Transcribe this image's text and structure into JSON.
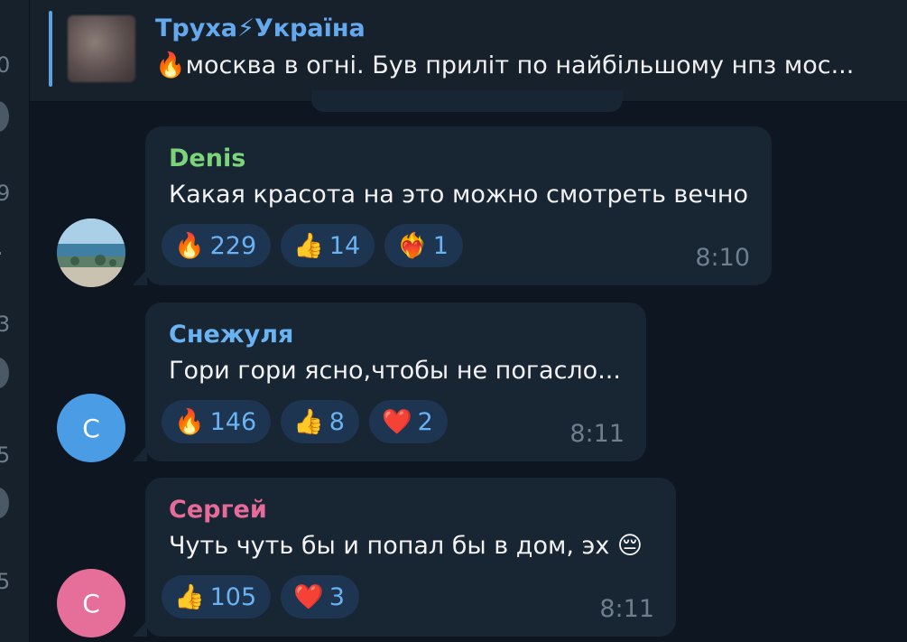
{
  "left_strip": {
    "digits": [
      "0",
      "9",
      ".",
      "3",
      "5",
      "5"
    ]
  },
  "pinned": {
    "title": "Труха⚡Україна",
    "text": "🔥москва в огні.  Був приліт по найбільшому нпз мос..."
  },
  "messages": [
    {
      "author": "Denis",
      "author_color": "#7cd47a",
      "text": "Какая красота на это можно смотреть вечно",
      "reactions": [
        {
          "emoji": "🔥",
          "count": "229"
        },
        {
          "emoji": "👍",
          "count": "14"
        },
        {
          "emoji": "❤️‍🔥",
          "count": "1"
        }
      ],
      "time": "8:10",
      "avatar": {
        "type": "photo",
        "letter": ""
      }
    },
    {
      "author": "Снежуля",
      "author_color": "#6ab3f3",
      "text": "Гори гори ясно,чтобы не погасло...",
      "reactions": [
        {
          "emoji": "🔥",
          "count": "146"
        },
        {
          "emoji": "👍",
          "count": "8"
        },
        {
          "emoji": "❤️",
          "count": "2"
        }
      ],
      "time": "8:11",
      "avatar": {
        "type": "letter",
        "letter": "С",
        "color": "#4a9ce4"
      }
    },
    {
      "author": "Сергей",
      "author_color": "#e66b9a",
      "text": "Чуть чуть бы и попал бы в дом, эх 😔",
      "reactions": [
        {
          "emoji": "👍",
          "count": "105"
        },
        {
          "emoji": "❤️",
          "count": "3"
        }
      ],
      "time": "8:11",
      "avatar": {
        "type": "letter",
        "letter": "С",
        "color": "#e56f98"
      }
    }
  ]
}
